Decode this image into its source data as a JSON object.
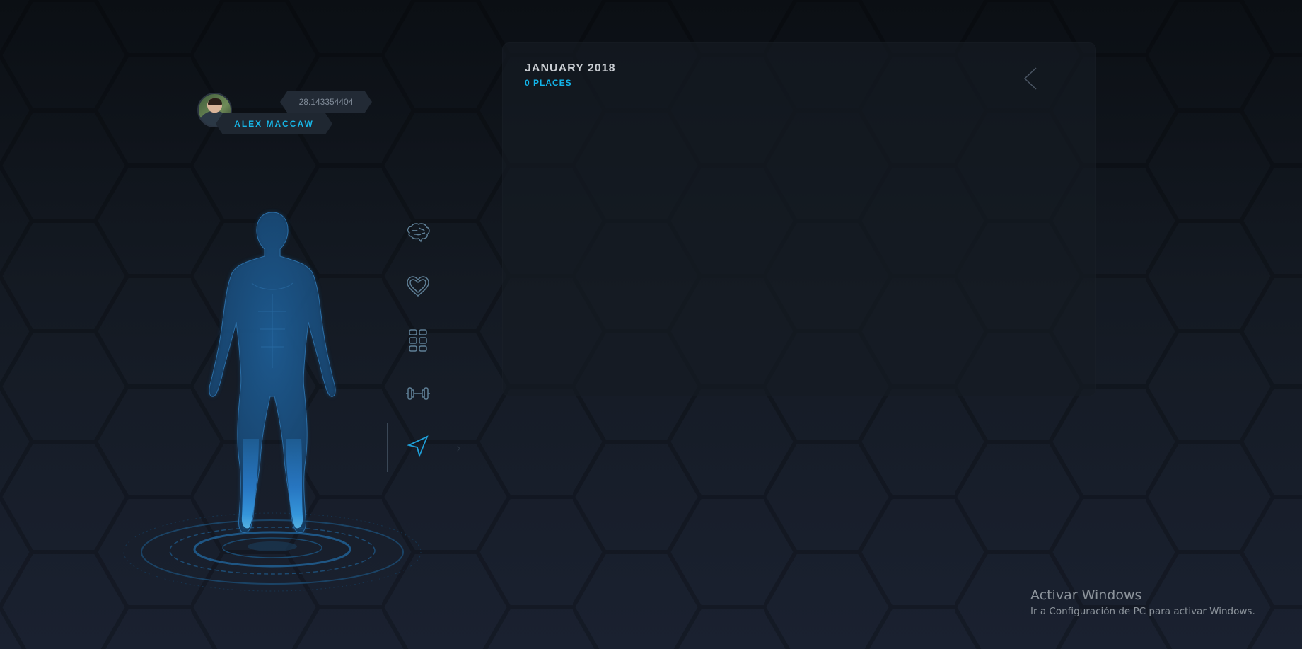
{
  "user": {
    "name": "ALEX MACCAW",
    "coordinate": "28.143354404"
  },
  "nav": {
    "items": [
      {
        "icon": "brain-icon"
      },
      {
        "icon": "heart-icon"
      },
      {
        "icon": "grid-icon"
      },
      {
        "icon": "dumbbell-icon"
      },
      {
        "icon": "location-arrow-icon"
      }
    ],
    "active": "location-arrow-icon"
  },
  "panel": {
    "title": "JANUARY 2018",
    "subtitle": "0 PLACES"
  },
  "watermark": {
    "title": "Activar Windows",
    "subtitle": "Ir a Configuración de PC para activar Windows."
  },
  "colors": {
    "accent": "#13b5ea",
    "background": "#141a23",
    "icon": "#5f7f96"
  }
}
